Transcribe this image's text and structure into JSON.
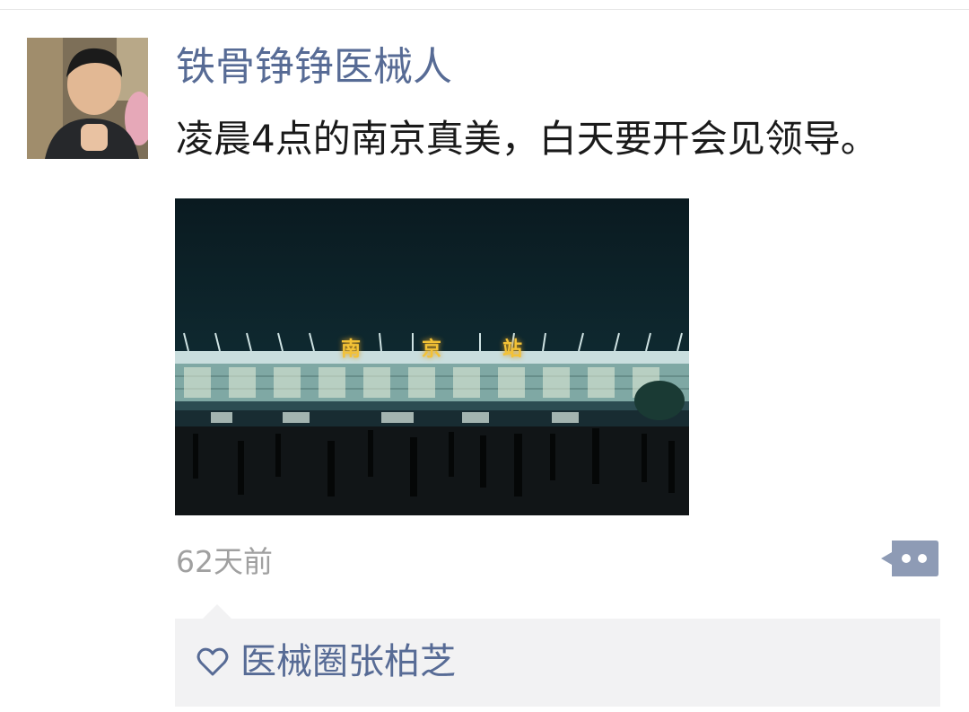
{
  "post": {
    "author": "铁骨铮铮医械人",
    "text": "凌晨4点的南京真美，白天要开会见领导。",
    "time": "62天前",
    "photo": {
      "sign_chars": [
        "南",
        "京",
        "站"
      ]
    },
    "likes": {
      "icon": "heart-outline-icon",
      "names": "医械圈张柏芝"
    },
    "comment_icon": "comment-dots-icon"
  },
  "colors": {
    "link": "#576b95",
    "text": "#1a1a1a",
    "muted": "#a0a0a0",
    "like_bg": "#f2f2f3",
    "comment_icon": "#8e9bb5"
  }
}
